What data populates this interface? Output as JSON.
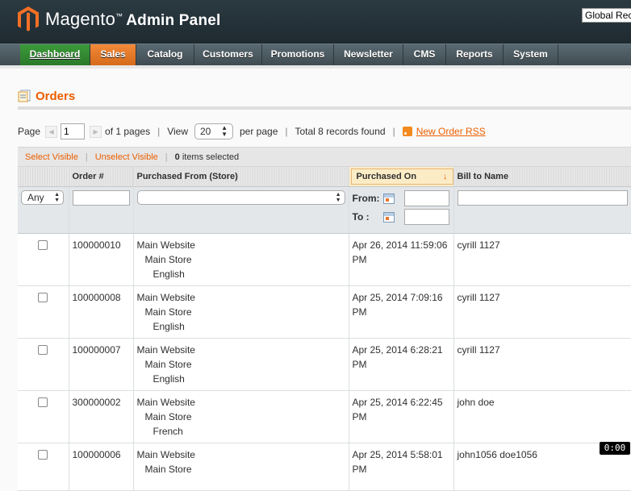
{
  "header": {
    "logo_text": "Magento",
    "logo_tm": "™",
    "logo_sub": "Admin Panel",
    "scope_select": "Global Record Search"
  },
  "nav": {
    "items": [
      {
        "label": "Dashboard"
      },
      {
        "label": "Sales"
      },
      {
        "label": "Catalog"
      },
      {
        "label": "Customers"
      },
      {
        "label": "Promotions"
      },
      {
        "label": "Newsletter"
      },
      {
        "label": "CMS"
      },
      {
        "label": "Reports"
      },
      {
        "label": "System"
      }
    ],
    "colors": {
      "dashboard": "#2b7a2a",
      "sales": "#e57a26"
    }
  },
  "page": {
    "title": "Orders",
    "title_icon": "orders-icon",
    "accent_color": "#eb5e00"
  },
  "pager": {
    "page_label": "Page",
    "page_value": "1",
    "of_pages": "of 1 pages",
    "view_label": "View",
    "view_value": "20",
    "per_page": "per page",
    "total": "Total 8 records found",
    "rss_link": "New Order RSS"
  },
  "massaction": {
    "select_visible": "Select Visible",
    "unselect_visible": "Unselect Visible",
    "selected_count": "0",
    "selected_suffix": "items selected"
  },
  "grid": {
    "columns": {
      "order": "Order #",
      "store": "Purchased From (Store)",
      "purchased_on": "Purchased On",
      "bill_to": "Bill to Name"
    },
    "sorted_column": "purchased_on",
    "sort_direction": "desc",
    "filters": {
      "massaction_any": "Any",
      "from_label": "From:",
      "to_label": "To :"
    },
    "rows": [
      {
        "order": "100000010",
        "store1": "Main Website",
        "store2": "Main Store",
        "store3": "English",
        "date": "Apr 26, 2014 11:59:06 PM",
        "bill_to": "cyrill 1127"
      },
      {
        "order": "100000008",
        "store1": "Main Website",
        "store2": "Main Store",
        "store3": "English",
        "date": "Apr 25, 2014 7:09:16 PM",
        "bill_to": "cyrill 1127"
      },
      {
        "order": "100000007",
        "store1": "Main Website",
        "store2": "Main Store",
        "store3": "English",
        "date": "Apr 25, 2014 6:28:21 PM",
        "bill_to": "cyrill 1127"
      },
      {
        "order": "300000002",
        "store1": "Main Website",
        "store2": "Main Store",
        "store3": "French",
        "date": "Apr 25, 2014 6:22:45 PM",
        "bill_to": "john doe"
      },
      {
        "order": "100000006",
        "store1": "Main Website",
        "store2": "Main Store",
        "store3": "",
        "date": "Apr 25, 2014 5:58:01 PM",
        "bill_to": "john1056 doe1056"
      }
    ]
  },
  "overlay": {
    "clock": "0:00"
  }
}
